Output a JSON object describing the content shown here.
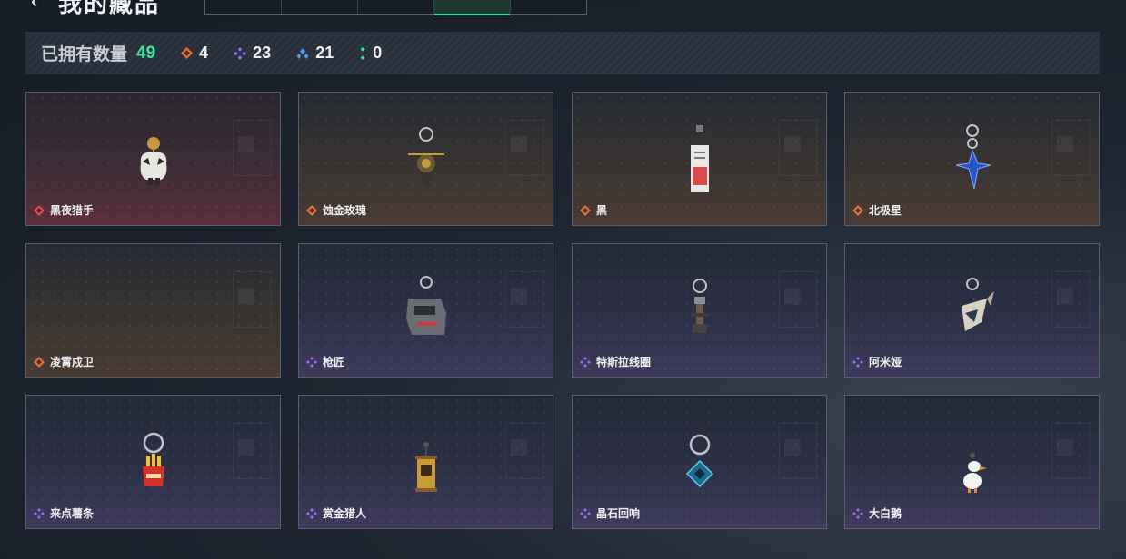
{
  "header": {
    "back_icon": "chevron-left-icon",
    "title": "我的藏品",
    "tabs": [
      {
        "label": "",
        "active": false
      },
      {
        "label": "",
        "active": false
      },
      {
        "label": "",
        "active": false
      },
      {
        "label": "",
        "active": true
      },
      {
        "label": "",
        "active": false
      }
    ]
  },
  "summary": {
    "label": "已拥有数量",
    "total": "49",
    "stats": [
      {
        "icon": "orange-gem-icon",
        "color": "#e0703f",
        "count": "4"
      },
      {
        "icon": "purple-gem-icon",
        "color": "#9a6cf0",
        "count": "23"
      },
      {
        "icon": "blue-gem-icon",
        "color": "#4d9cf0",
        "count": "21"
      },
      {
        "icon": "green-gem-icon",
        "color": "#3fe39a",
        "count": "0"
      }
    ]
  },
  "colors": {
    "accent_green": "#3fe39a",
    "rarity_red": "#e04a5a",
    "rarity_orange": "#e0703f",
    "rarity_purple": "#9a6cf0"
  },
  "items": [
    {
      "name": "黑夜猎手",
      "rarity": "red",
      "icon": "cat-figure-charm-icon"
    },
    {
      "name": "蚀金玫瑰",
      "rarity": "orange",
      "icon": "rose-pendant-charm-icon"
    },
    {
      "name": "黑",
      "rarity": "orange",
      "icon": "tag-charm-icon"
    },
    {
      "name": "北极星",
      "rarity": "orange",
      "icon": "star-pendant-charm-icon"
    },
    {
      "name": "凌霄戍卫",
      "rarity": "orange",
      "icon": "empty-charm-icon"
    },
    {
      "name": "枪匠",
      "rarity": "purple",
      "icon": "dogtag-charm-icon"
    },
    {
      "name": "特斯拉线圈",
      "rarity": "purple",
      "icon": "tesla-coil-charm-icon"
    },
    {
      "name": "阿米娅",
      "rarity": "purple",
      "icon": "drill-charm-icon"
    },
    {
      "name": "来点薯条",
      "rarity": "purple",
      "icon": "fries-charm-icon"
    },
    {
      "name": "赏金猎人",
      "rarity": "purple",
      "icon": "wanted-poster-charm-icon"
    },
    {
      "name": "晶石回响",
      "rarity": "purple",
      "icon": "crystal-charm-icon"
    },
    {
      "name": "大白鹅",
      "rarity": "purple",
      "icon": "goose-charm-icon"
    }
  ]
}
